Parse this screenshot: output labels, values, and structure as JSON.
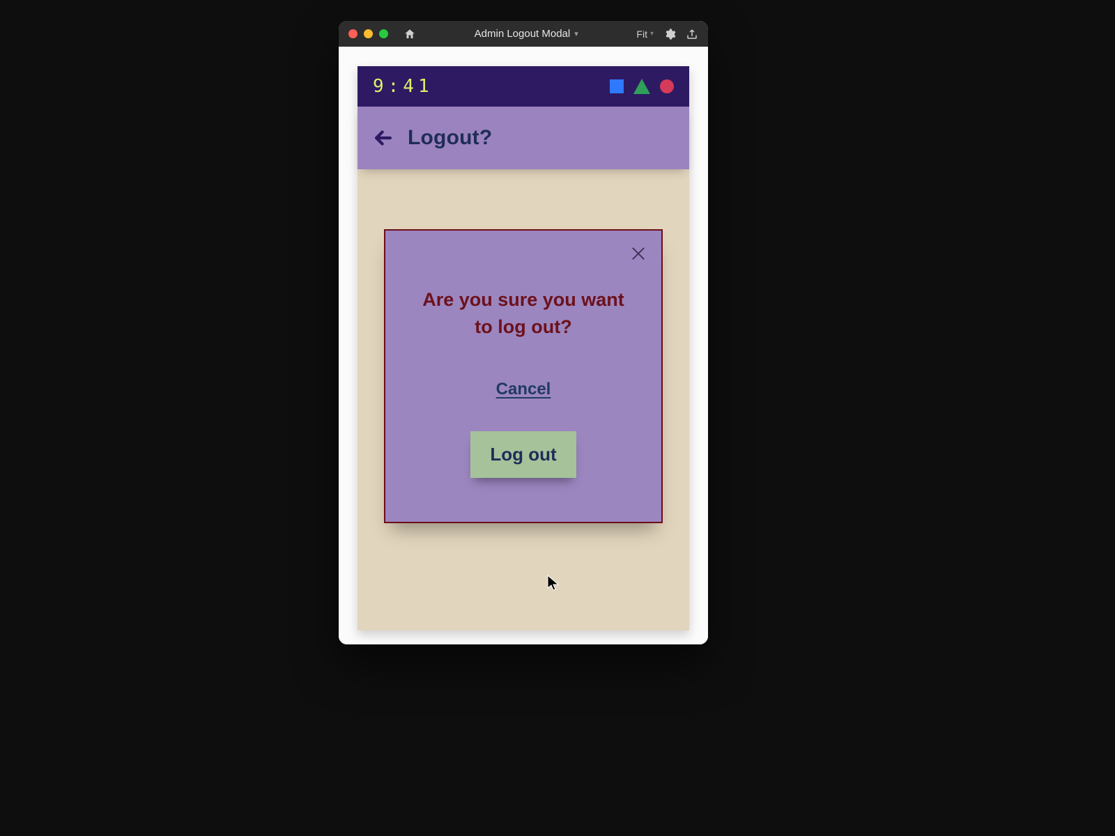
{
  "window": {
    "title": "Admin Logout Modal",
    "zoom_label": "Fit"
  },
  "statusbar": {
    "time": "9:41"
  },
  "header": {
    "title": "Logout?"
  },
  "modal": {
    "message": "Are you sure you want to log out?",
    "cancel_label": "Cancel",
    "logout_label": "Log out"
  }
}
